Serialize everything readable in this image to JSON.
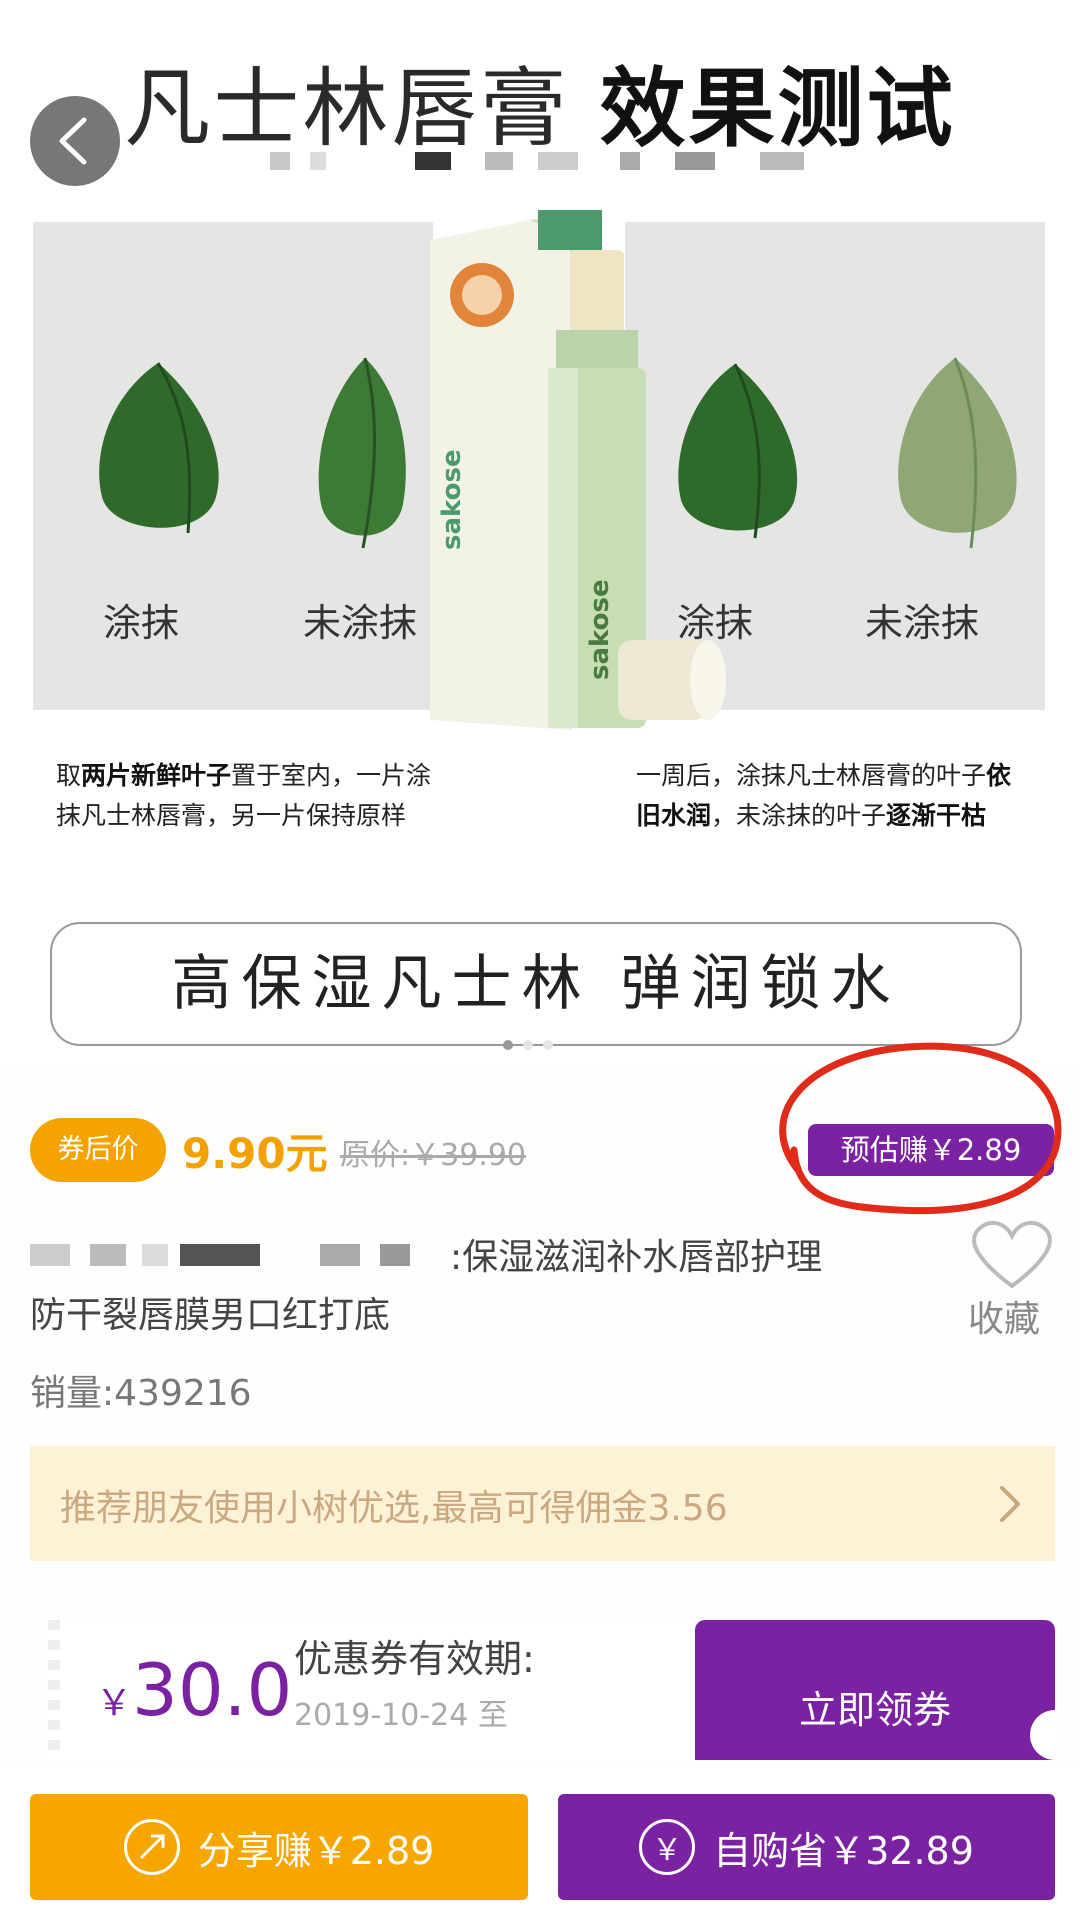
{
  "banner": {
    "title_light": "凡士林唇膏",
    "title_bold": "效果测试",
    "leaf_labels": [
      "涂抹",
      "未涂抹",
      "涂抹",
      "未涂抹"
    ],
    "product_brand": "sakose",
    "caption_left": {
      "p1": "取",
      "b1": "两片新鲜叶子",
      "p2": "置于室内，一片涂抹凡士林唇膏，另一片保持原样"
    },
    "caption_right": {
      "p1": "一周后，涂抹凡士林唇膏的叶子",
      "b1": "依旧水润",
      "p2": "，未涂抹的叶子",
      "b2": "逐渐干枯"
    },
    "slogan": "高保湿凡士林 弹润锁水"
  },
  "price": {
    "badge_label": "券后价",
    "value": "9.90元",
    "original": "原价:￥39.90",
    "estimate_earn": "预估赚￥2.89"
  },
  "product": {
    "title_line1": ":保湿滋润补水唇部护理",
    "title_line2": "防干裂唇膜男口红打底",
    "favorite_label": "收藏",
    "sales": "销量:439216"
  },
  "recommend": {
    "text": "推荐朋友使用小树优选,最高可得佣金3.56"
  },
  "coupon": {
    "currency_symbol": "￥",
    "amount": "30.0",
    "valid_label": "优惠券有效期:",
    "valid_date": "2019-10-24 至",
    "claim_label": "立即领券"
  },
  "bottom_bar": {
    "share_label": "分享赚￥2.89",
    "buy_label": "自购省￥32.89",
    "buy_icon": "￥"
  },
  "colors": {
    "accent_purple": "#7b22a3",
    "accent_orange": "#f5a300",
    "highlight_red": "#e02a1a"
  },
  "icons": [
    "back-arrow-icon",
    "heart-icon",
    "chevron-right-icon",
    "share-icon",
    "yuan-icon"
  ]
}
